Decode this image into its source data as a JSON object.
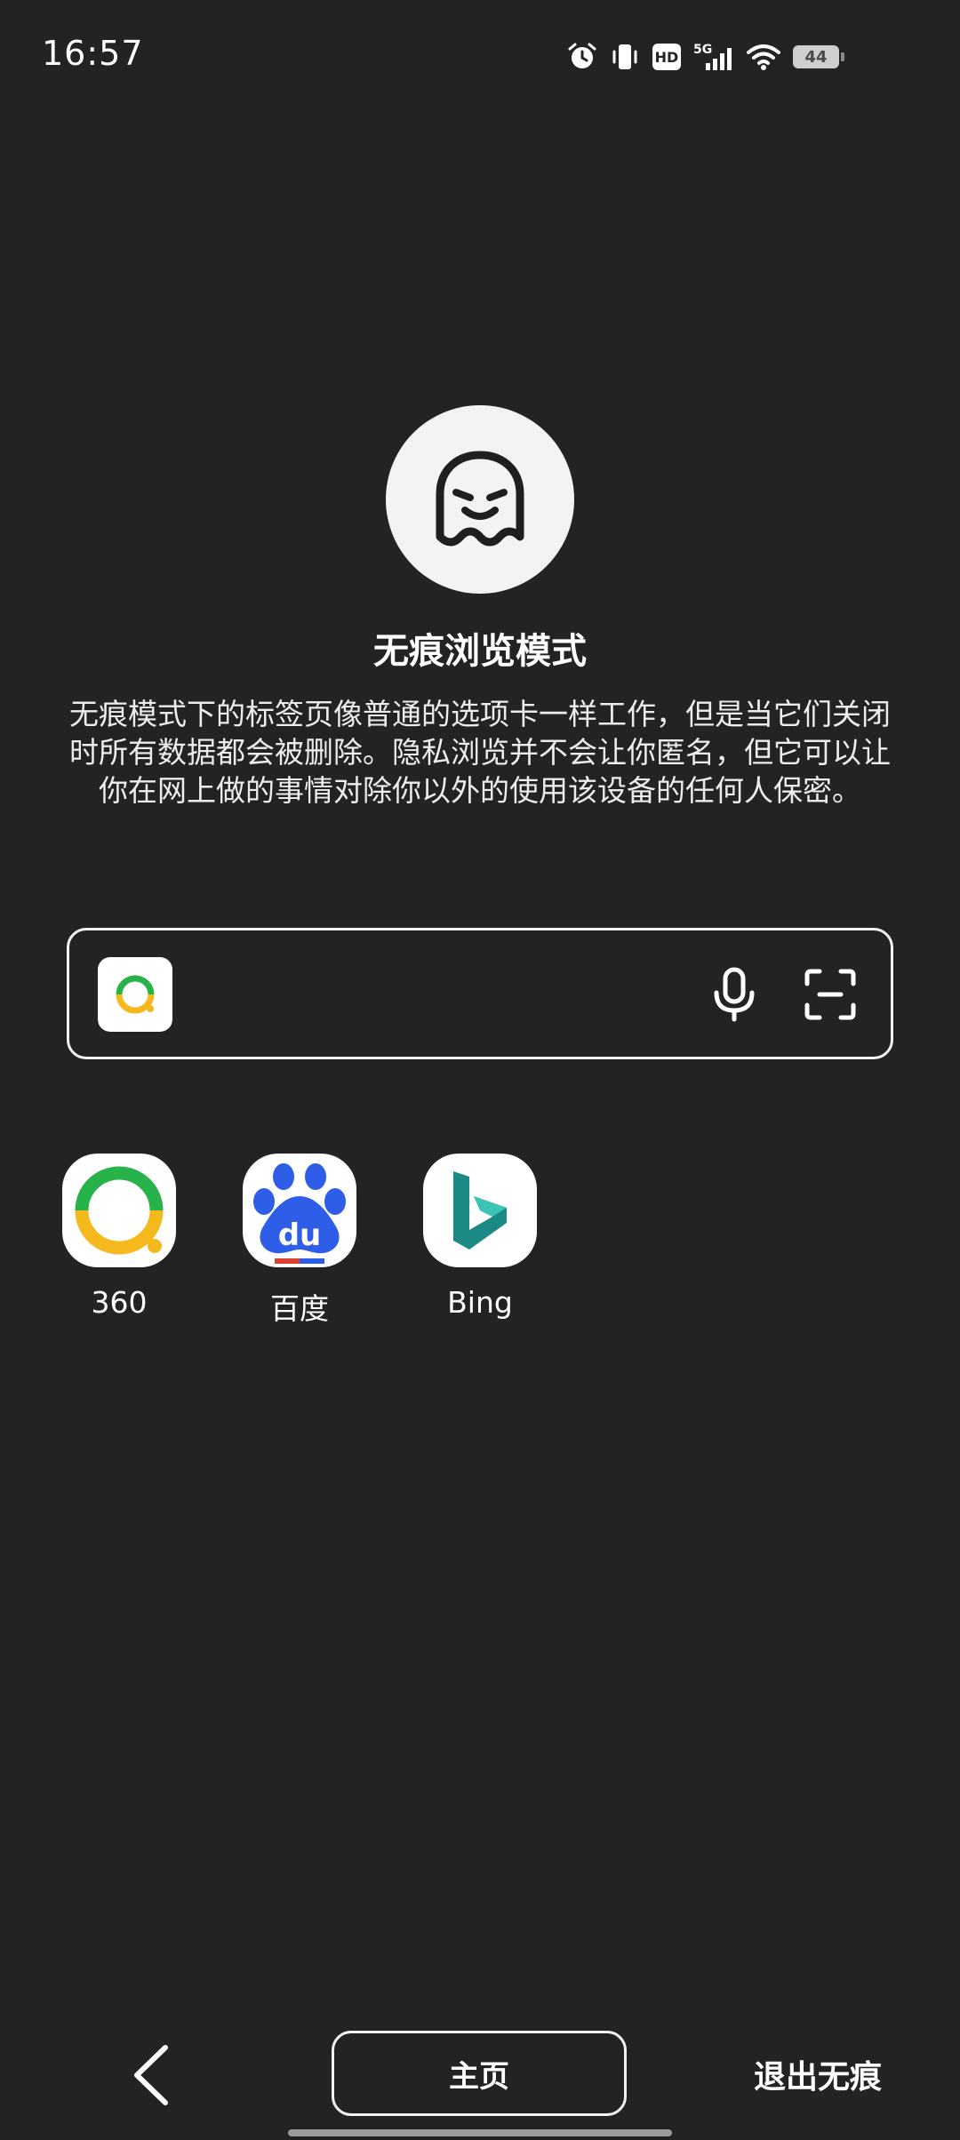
{
  "status_bar": {
    "time": "16:57",
    "network": "5G",
    "hd_label": "HD",
    "battery": "44",
    "icons": [
      "alarm-icon",
      "vibrate-icon",
      "hd-icon",
      "5g-signal-icon",
      "wifi-icon",
      "battery-icon"
    ]
  },
  "incognito": {
    "icon": "ghost-icon",
    "title": "无痕浏览模式",
    "description": "无痕模式下的标签页像普通的选项卡一样工作，但是当它们关闭时所有数据都会被删除。隐私浏览并不会让你匿名，但它可以让你在网上做的事情对除你以外的使用该设备的任何人保密。"
  },
  "search": {
    "engine_icon": "360-search-icon",
    "value": "",
    "placeholder": "",
    "voice_icon": "microphone-icon",
    "scan_icon": "scan-icon"
  },
  "shortcuts": [
    {
      "label": "360",
      "icon": "360-logo-icon"
    },
    {
      "label": "百度",
      "icon": "baidu-logo-icon"
    },
    {
      "label": "Bing",
      "icon": "bing-logo-icon"
    }
  ],
  "bottom_bar": {
    "back_icon": "chevron-left-icon",
    "home_label": "主页",
    "exit_label": "退出无痕"
  },
  "colors": {
    "background": "#232323",
    "text": "#ffffff",
    "outline": "#f2f2f2",
    "green_360": "#27b24a",
    "yellow_360": "#f5b91d",
    "baidu_blue": "#2e5ee8",
    "bing_teal": "#1b8a85"
  }
}
